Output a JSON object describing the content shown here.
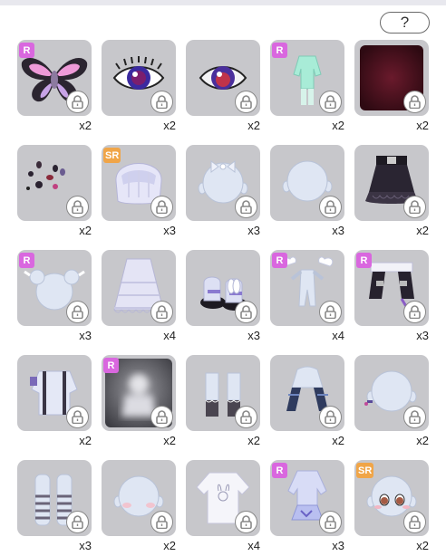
{
  "help": {
    "label": "?"
  },
  "items": [
    {
      "art": "butterfly-wings",
      "rarity": "R",
      "count": "x2"
    },
    {
      "art": "eye-lashes",
      "rarity": "",
      "count": "x2"
    },
    {
      "art": "eye-red",
      "rarity": "",
      "count": "x2"
    },
    {
      "art": "mint-outfit",
      "rarity": "R",
      "count": "x2"
    },
    {
      "art": "dark-red-background",
      "rarity": "",
      "count": "x2"
    },
    {
      "art": "scattered-gems",
      "rarity": "",
      "count": "x2"
    },
    {
      "art": "silver-hair",
      "rarity": "SR",
      "count": "x3"
    },
    {
      "art": "bow-head",
      "rarity": "",
      "count": "x3"
    },
    {
      "art": "bald-head",
      "rarity": "",
      "count": "x3"
    },
    {
      "art": "black-skirt",
      "rarity": "",
      "count": "x2"
    },
    {
      "art": "head-pigtails",
      "rarity": "R",
      "count": "x3"
    },
    {
      "art": "lace-dress",
      "rarity": "",
      "count": "x4"
    },
    {
      "art": "bunny-shoes",
      "rarity": "",
      "count": "x3"
    },
    {
      "art": "winged-body",
      "rarity": "R",
      "count": "x4"
    },
    {
      "art": "black-sleeves",
      "rarity": "R",
      "count": "x3"
    },
    {
      "art": "suspenders-top",
      "rarity": "",
      "count": "x2"
    },
    {
      "art": "blurred-figure",
      "rarity": "R",
      "count": "x2"
    },
    {
      "art": "dark-socks",
      "rarity": "",
      "count": "x2"
    },
    {
      "art": "blue-gloves",
      "rarity": "",
      "count": "x2"
    },
    {
      "art": "head-earring",
      "rarity": "",
      "count": "x2"
    },
    {
      "art": "striped-stockings",
      "rarity": "",
      "count": "x3"
    },
    {
      "art": "blush-head",
      "rarity": "",
      "count": "x2"
    },
    {
      "art": "bunny-sweater",
      "rarity": "",
      "count": "x4"
    },
    {
      "art": "lavender-outfit",
      "rarity": "R",
      "count": "x3"
    },
    {
      "art": "blushing-face",
      "rarity": "SR",
      "count": "x2"
    }
  ]
}
